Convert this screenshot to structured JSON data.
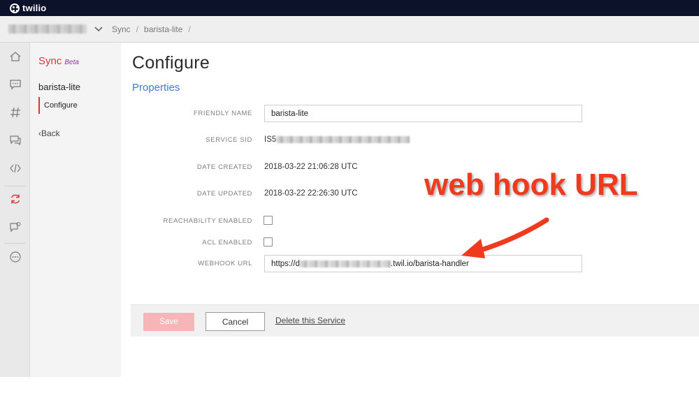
{
  "brand": {
    "logo_text": "twilio"
  },
  "breadcrumb": {
    "product": "Sync",
    "service": "barista-lite",
    "sep": "/"
  },
  "rail": [
    "home-icon",
    "chat-icon",
    "hash-icon",
    "messages-icon",
    "code-icon",
    "sync-icon",
    "studio-icon",
    "more-icon"
  ],
  "subnav": {
    "title": "Sync",
    "badge": "Beta",
    "service": "barista-lite",
    "active_item": "Configure",
    "back_label": "Back",
    "back_chevron": "‹"
  },
  "page": {
    "title": "Configure",
    "section": "Properties"
  },
  "fields": {
    "friendly_name": {
      "label": "FRIENDLY NAME",
      "value": "barista-lite"
    },
    "service_sid": {
      "label": "SERVICE SID",
      "value_prefix": "IS5"
    },
    "date_created": {
      "label": "DATE CREATED",
      "value": "2018-03-22 21:06:28 UTC"
    },
    "date_updated": {
      "label": "DATE UPDATED",
      "value": "2018-03-22 22:26:30 UTC"
    },
    "reachability": {
      "label": "REACHABILITY ENABLED",
      "checked": false
    },
    "acl": {
      "label": "ACL ENABLED",
      "checked": false
    },
    "webhook": {
      "label": "WEBHOOK URL",
      "value_prefix": "https://d",
      "value_suffix": ".twil.io/barista-handler"
    }
  },
  "actions": {
    "save": "Save",
    "cancel": "Cancel",
    "delete": "Delete this Service"
  },
  "annotation": {
    "text": "web hook URL",
    "color": "#f03a1d"
  },
  "colors": {
    "accent_red": "#e0313b",
    "link_blue": "#3a7bd5",
    "topbar": "#0d122b"
  }
}
